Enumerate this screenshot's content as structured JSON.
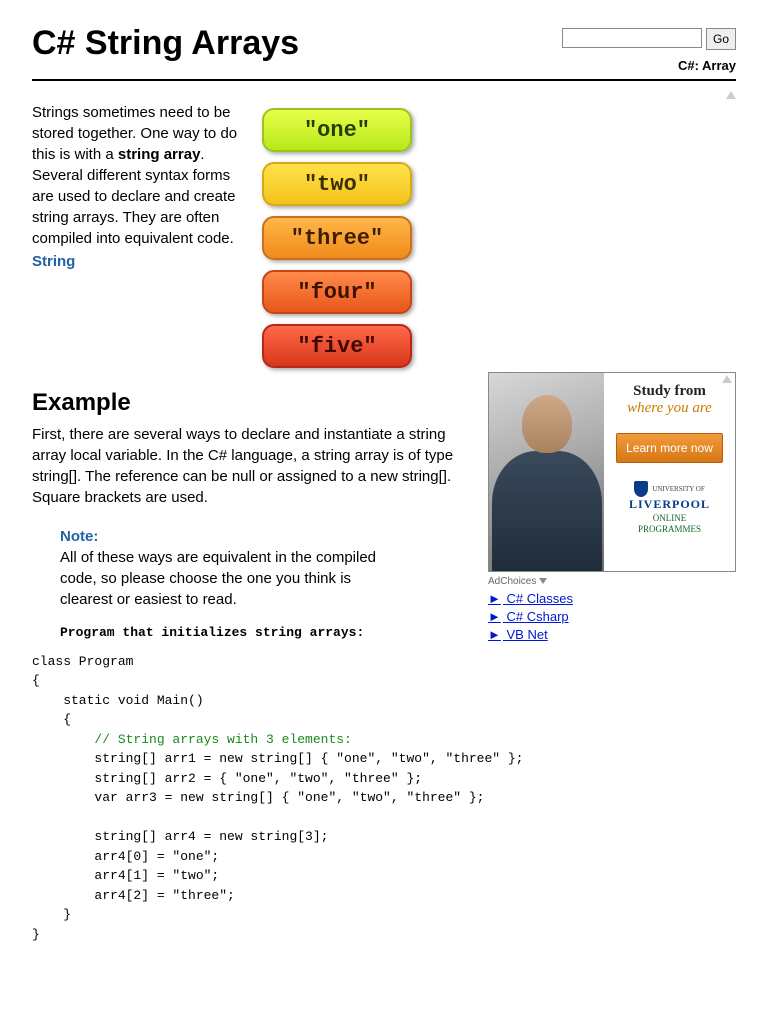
{
  "search": {
    "go": "Go",
    "value": ""
  },
  "breadcrumb": {
    "lang": "C#",
    "sep": ": ",
    "topic": "Array"
  },
  "title": "C# String Arrays",
  "intro": {
    "text_before_bold": "Strings sometimes need to be stored together. One way to do this is with a ",
    "bold": "string array",
    "text_after_bold": ". Several different syntax forms are used to declare and create string arrays. They are often compiled into equivalent code.",
    "string_link": "String"
  },
  "pills": [
    "\"one\"",
    "\"two\"",
    "\"three\"",
    "\"four\"",
    "\"five\""
  ],
  "example": {
    "heading": "Example",
    "body": "First, there are several ways to declare and instantiate a string array local variable. In the C# language, a string array is of type string[]. The reference can be null or assigned to a new string[]. Square brackets are used."
  },
  "note": {
    "label": "Note:",
    "body": "All of these ways are equivalent in the compiled code, so please choose the one you think is clearest or easiest to read."
  },
  "code_title": "Program that initializes string arrays:",
  "code": {
    "l1": "class Program",
    "l2": "{",
    "l3": "    static void Main()",
    "l4": "    {",
    "c1": "        // String arrays with 3 elements:",
    "l5": "        string[] arr1 = new string[] { \"one\", \"two\", \"three\" };",
    "l6": "        string[] arr2 = { \"one\", \"two\", \"three\" };",
    "l7": "        var arr3 = new string[] { \"one\", \"two\", \"three\" };",
    "l8": "",
    "l9": "        string[] arr4 = new string[3];",
    "l10": "        arr4[0] = \"one\";",
    "l11": "        arr4[1] = \"two\";",
    "l12": "        arr4[2] = \"three\";",
    "l13": "    }",
    "l14": "}"
  },
  "ad": {
    "study": "Study from",
    "where": "where you are",
    "button": "Learn more now",
    "uni_top": "UNIVERSITY OF",
    "uni_name": "LIVERPOOL",
    "prog1": "ONLINE",
    "prog2": "PROGRAMMES",
    "adchoices": "AdChoices",
    "links": [
      "C# Classes",
      "C# Csharp",
      "VB Net"
    ]
  }
}
